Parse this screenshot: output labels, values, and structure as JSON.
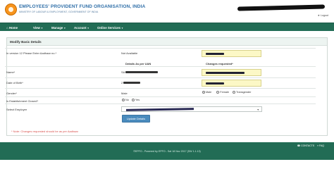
{
  "header": {
    "org_name": "EMPLOYEES' PROVIDENT FUND ORGANISATION, INDIA",
    "org_subtitle": "MINISTRY OF LABOUR & EMPLOYMENT, GOVERNMENT OF INDIA",
    "links": [
      "★ Logout"
    ]
  },
  "nav": {
    "items": [
      {
        "label": "⌂ Home",
        "has_caret": false
      },
      {
        "label": "View",
        "has_caret": true
      },
      {
        "label": "Manage",
        "has_caret": true
      },
      {
        "label": "Account",
        "has_caret": true
      },
      {
        "label": "Online Services",
        "has_caret": true
      }
    ]
  },
  "panel": {
    "title": "Modify Basic Details",
    "aadhaar_label": "In version 12 Please Enter Aadhaar no.*",
    "aadhaar_value": "Not Available",
    "col_per_uan": "Details As per UAN",
    "col_changes": "Changes requested*",
    "name_label": "Name*",
    "name_value_prefix": "SA",
    "dob_label": "Date of Birth*",
    "dob_value_prefix": "2",
    "gender_label": "Gender*",
    "gender_value": "Male",
    "gender_options": [
      "Male",
      "Female",
      "Transgender"
    ],
    "gender_selected": "Male",
    "establishment_label": "Is Establishment Closed?",
    "establishment_options": [
      "No",
      "Yes"
    ],
    "establishment_selected": "No",
    "employer_label": "Select Employer",
    "update_button": "Update Details",
    "note": "* Note: Changes requested should be as per Aadhaar"
  },
  "footer": {
    "links": [
      "☎ CONTACTS",
      "» FAQ"
    ],
    "text": "©EPFO - Powered by EPFO - Sat 18 Nov 2017 (SW 1.1.13)"
  },
  "colors": {
    "nav_bg": "#226c55",
    "field_highlight": "#fcf8c6",
    "button_bg": "#4a8bbd",
    "note_text": "#d9534f",
    "org_title": "#2f6fa8"
  }
}
